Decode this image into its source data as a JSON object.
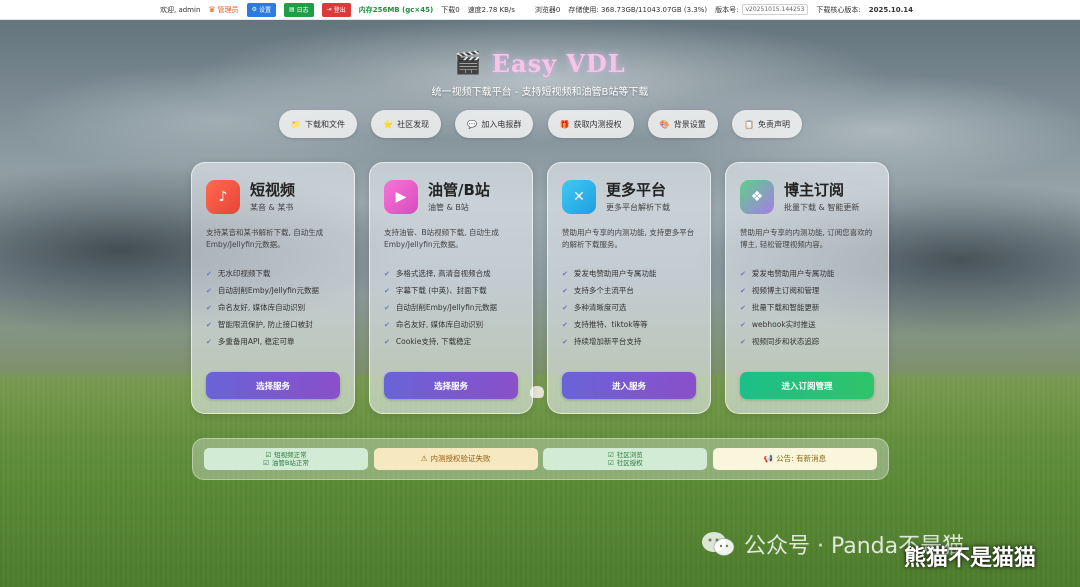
{
  "topbar": {
    "welcome": "欢迎, admin",
    "admin_label": "管理员",
    "settings_label": "设置",
    "log_label": "日志",
    "logout_label": "登出",
    "memory": "内存256MB (gc×45)",
    "downloading": "下载0",
    "speed": "速度2.78 KB/s",
    "browser": "浏览器0",
    "storage": "存储使用: 368.73GB/11043.07GB (3.3%)",
    "version_label": "版本号:",
    "version_value": "v20251015.144253",
    "core_label": "下载核心版本:",
    "core_value": "2025.10.14"
  },
  "header": {
    "title": "Easy VDL",
    "subtitle": "统一视频下载平台 - 支持短视频和油管B站等下载"
  },
  "nav": [
    {
      "icon": "folder-icon",
      "glyph": "📁",
      "label": "下载和文件"
    },
    {
      "icon": "star-icon",
      "glyph": "⭐",
      "label": "社区发现"
    },
    {
      "icon": "chat-icon",
      "glyph": "💬",
      "label": "加入电报群"
    },
    {
      "icon": "gift-icon",
      "glyph": "🎁",
      "label": "获取内测授权"
    },
    {
      "icon": "palette-icon",
      "glyph": "🎨",
      "label": "背景设置"
    },
    {
      "icon": "clipboard-icon",
      "glyph": "📋",
      "label": "免责声明"
    }
  ],
  "cards": [
    {
      "title": "短视频",
      "sub": "某音 & 某书",
      "desc": "支持某音和某书解析下载, 自动生成Emby/Jellyfin元数据。",
      "features": [
        "无水印视频下载",
        "自动刮削Emby/Jellyfin元数据",
        "命名友好, 媒体库自动识别",
        "智能限流保护, 防止接口被封",
        "多重备用API, 稳定可靠"
      ],
      "button": "选择服务"
    },
    {
      "title": "油管/B站",
      "sub": "油管 & B站",
      "desc": "支持油管、B站视频下载, 自动生成Emby/Jellyfin元数据。",
      "features": [
        "多格式选择, 高清音视频合成",
        "字幕下载 (中英)、封面下载",
        "自动刮削Emby/Jellyfin元数据",
        "命名友好, 媒体库自动识别",
        "Cookie支持, 下载稳定"
      ],
      "button": "选择服务"
    },
    {
      "title": "更多平台",
      "sub": "更多平台解析下载",
      "desc": "赞助用户专享的内测功能, 支持更多平台的解析下载服务。",
      "features": [
        "爱发电赞助用户专属功能",
        "支持多个主流平台",
        "多种清晰度可选",
        "支持推特、tiktok等等",
        "持续增加新平台支持"
      ],
      "button": "进入服务"
    },
    {
      "title": "博主订阅",
      "sub": "批量下载 & 智能更新",
      "desc": "赞助用户专享的内测功能, 订阅您喜欢的博主, 轻松管理视频内容。",
      "features": [
        "爱发电赞助用户专属功能",
        "视频博主订阅和管理",
        "批量下载和智能更新",
        "webhook实时推送",
        "视频同步和状态追踪"
      ],
      "button": "进入订阅管理"
    }
  ],
  "status": {
    "s1_line1": "短视频正常",
    "s1_line2": "油管B站正常",
    "s2": "内测授权验证失败",
    "s3_line1": "社区浏览",
    "s3_line2": "社区授权",
    "s4": "公告: 有新消息"
  },
  "watermark": {
    "text": "公众号 · Panda不是猫",
    "overlay": "熊猫不是猫猫"
  },
  "colors": {
    "accent_purple": "#6a63d8",
    "accent_green": "#1bbf8a",
    "settings_btn": "#2d7be0",
    "log_btn": "#1f9d47",
    "logout_btn": "#dc3a3a"
  }
}
